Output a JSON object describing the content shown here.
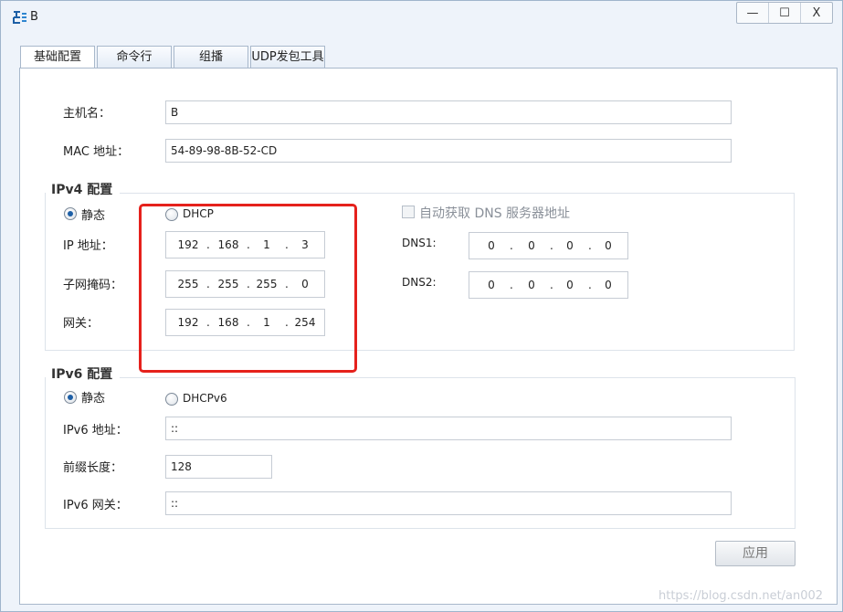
{
  "window": {
    "title": "B",
    "controls": {
      "minimize": "—",
      "maximize": "☐",
      "close": "X"
    }
  },
  "tabs": [
    {
      "label": "基础配置",
      "active": true
    },
    {
      "label": "命令行",
      "active": false
    },
    {
      "label": "组播",
      "active": false
    },
    {
      "label": "UDP发包工具",
      "active": false
    }
  ],
  "host": {
    "hostname_label": "主机名：",
    "hostname_value": "B",
    "mac_label": "MAC 地址：",
    "mac_value": "54-89-98-8B-52-CD"
  },
  "ipv4": {
    "group_title": "IPv4 配置",
    "static_label": "静态",
    "dhcp_label": "DHCP",
    "mode": "static",
    "auto_dns_label": "自动获取 DNS 服务器地址",
    "ip_label": "IP 地址：",
    "ip": [
      "192",
      "168",
      "1",
      "3"
    ],
    "mask_label": "子网掩码：",
    "mask": [
      "255",
      "255",
      "255",
      "0"
    ],
    "gateway_label": "网关：",
    "gateway": [
      "192",
      "168",
      "1",
      "254"
    ],
    "dns1_label": "DNS1:",
    "dns1": [
      "0",
      "0",
      "0",
      "0"
    ],
    "dns2_label": "DNS2:",
    "dns2": [
      "0",
      "0",
      "0",
      "0"
    ]
  },
  "ipv6": {
    "group_title": "IPv6 配置",
    "static_label": "静态",
    "dhcp_label": "DHCPv6",
    "mode": "static",
    "address_label": "IPv6 地址：",
    "address_value": "::",
    "prefix_label": "前缀长度：",
    "prefix_value": "128",
    "gateway_label": "IPv6 网关：",
    "gateway_value": "::"
  },
  "apply_label": "应用",
  "watermark": "https://blog.csdn.net/an002",
  "colors": {
    "highlight": "#e5211c",
    "accent": "#1d5fa6"
  }
}
